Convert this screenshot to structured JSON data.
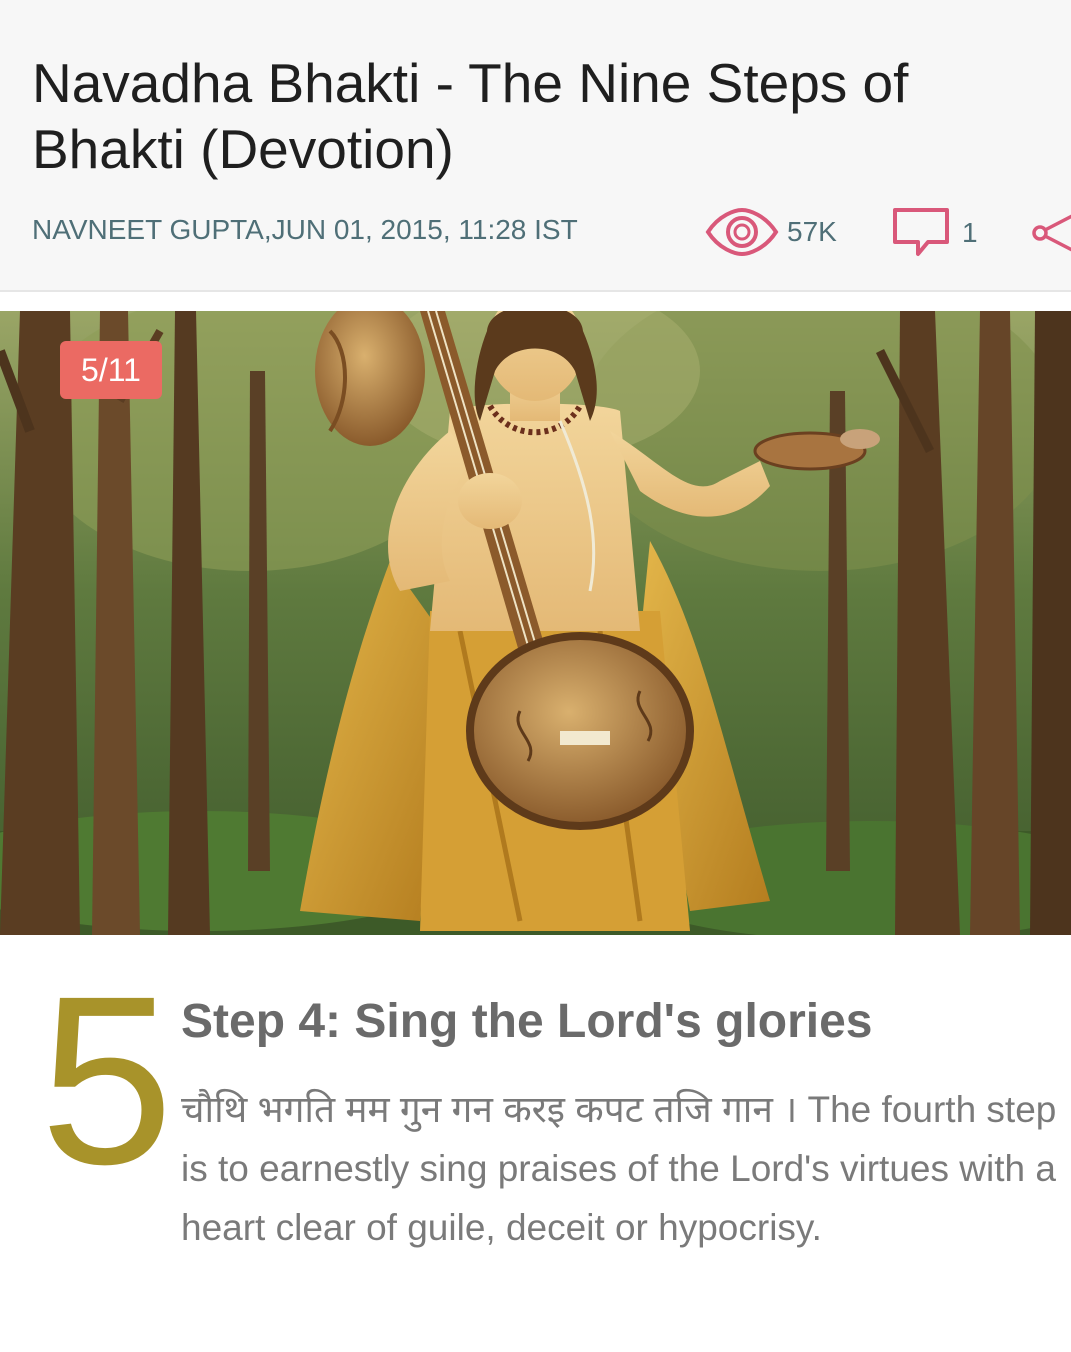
{
  "article": {
    "title": "Navadha Bhakti - The Nine Steps of Bhakti (Devotion)",
    "author_date": "NAVNEET GUPTA,JUN 01, 2015, 11:28 IST",
    "views": "57K",
    "comments": "1"
  },
  "icons": {
    "views": "eye-icon",
    "comments": "comment-icon",
    "share": "share-icon"
  },
  "gallery": {
    "counter": "5/11"
  },
  "step": {
    "number": "5",
    "heading": "Step 4: Sing the Lord's glories",
    "body": "चौथि भगति मम गुन गन करइ कपट तजि गान । The fourth step is to earnestly sing praises of the Lord's virtues with a heart clear of guile, deceit or hypocrisy."
  },
  "colors": {
    "accent_icon": "#d9587a",
    "badge": "#eb6a63",
    "step_number": "#a8932a",
    "meta_text": "#4f6f77"
  }
}
